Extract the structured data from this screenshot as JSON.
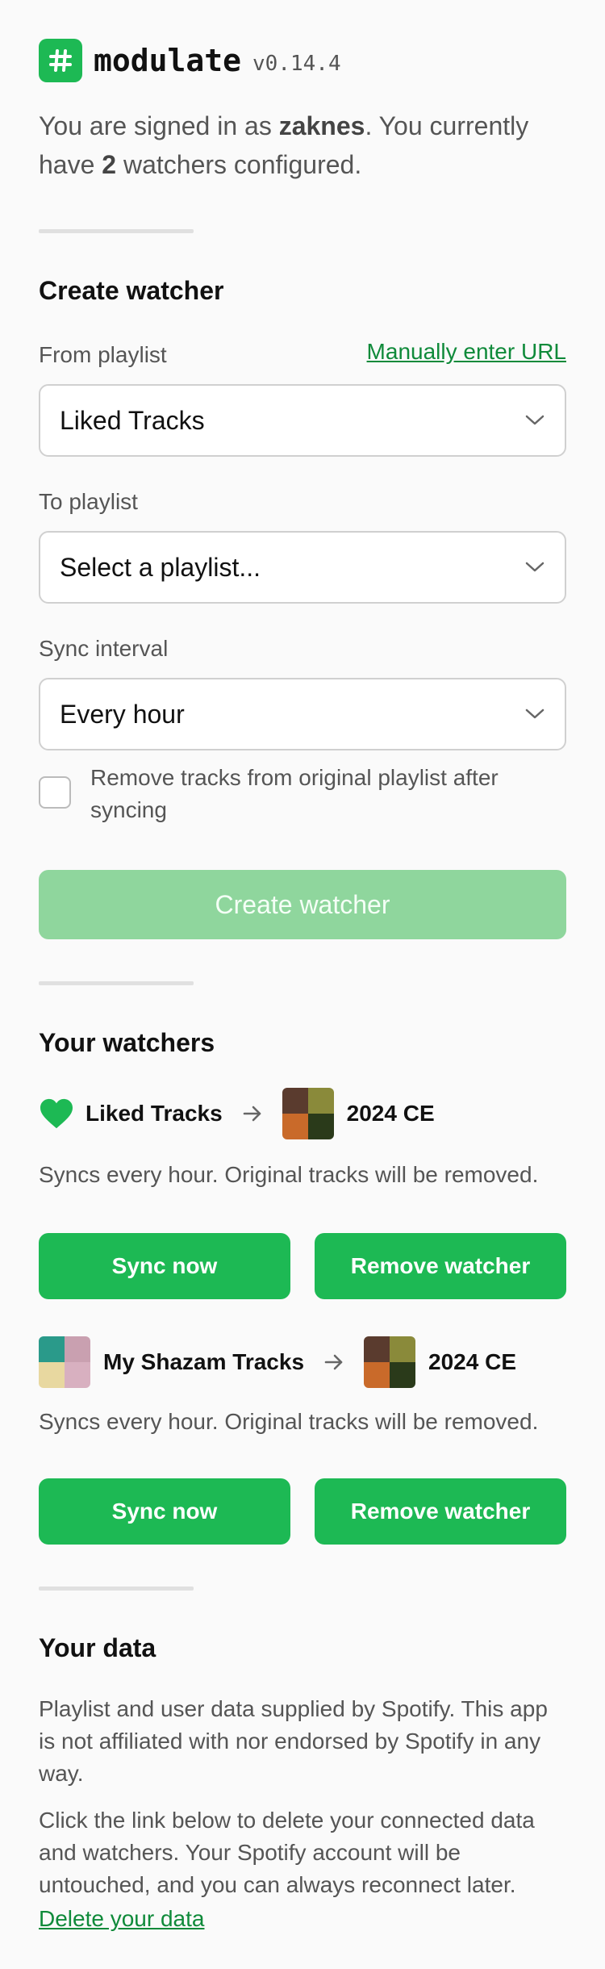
{
  "header": {
    "brand": "modulate",
    "version": "v0.14.4",
    "logo_icon": "hash-icon"
  },
  "account": {
    "text_prefix": "You are signed in as ",
    "username": "zaknes",
    "text_mid": ". You currently have ",
    "watcher_count": "2",
    "text_suffix": " watchers configured."
  },
  "create": {
    "heading": "Create watcher",
    "from_label": "From playlist",
    "manual_url_link": "Manually enter URL",
    "from_value": "Liked Tracks",
    "to_label": "To playlist",
    "to_value": "Select a playlist...",
    "interval_label": "Sync interval",
    "interval_value": "Every hour",
    "remove_checkbox_label": "Remove tracks from original playlist after syncing",
    "remove_checked": false,
    "submit_label": "Create watcher"
  },
  "watchers": {
    "heading": "Your watchers",
    "items": [
      {
        "from": "Liked Tracks",
        "to": "2024 CE",
        "description": "Syncs every hour. Original tracks will be removed.",
        "sync_label": "Sync now",
        "remove_label": "Remove watcher"
      },
      {
        "from": "My Shazam Tracks",
        "to": "2024 CE",
        "description": "Syncs every hour. Original tracks will be removed.",
        "sync_label": "Sync now",
        "remove_label": "Remove watcher"
      }
    ]
  },
  "data_section": {
    "heading": "Your data",
    "para1": "Playlist and user data supplied by Spotify. This app is not affiliated with nor endorsed by Spotify in any way.",
    "para2": "Click the link below to delete your connected data and watchers. Your Spotify account will be untouched, and you can always reconnect later.",
    "delete_link": "Delete your data"
  },
  "colors": {
    "accent": "#1db954",
    "accent_disabled": "#8fd69d",
    "link": "#0f8a3a"
  }
}
